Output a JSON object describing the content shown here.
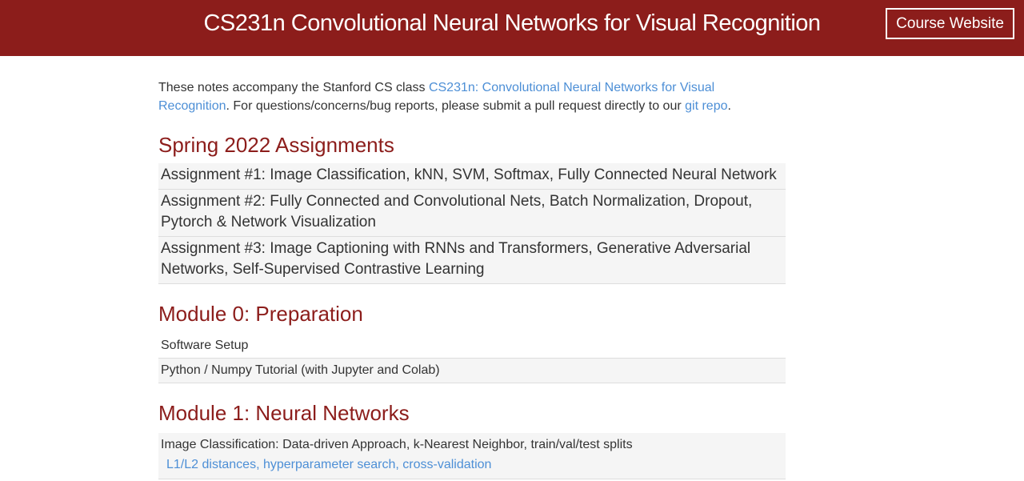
{
  "header": {
    "title": "CS231n Convolutional Neural Networks for Visual Recognition",
    "course_button": "Course Website"
  },
  "intro": {
    "text_before": "These notes accompany the Stanford CS class ",
    "link_class": "CS231n: Convolutional Neural Networks for Visual Recognition",
    "text_middle": ". For questions/concerns/bug reports, please submit a pull request directly to our ",
    "link_repo": "git repo",
    "text_after": "."
  },
  "assignments": {
    "title": "Spring 2022 Assignments",
    "items": [
      "Assignment #1: Image Classification, kNN, SVM, Softmax, Fully Connected Neural Network",
      "Assignment #2: Fully Connected and Convolutional Nets, Batch Normalization, Dropout, Pytorch & Network Visualization",
      "Assignment #3: Image Captioning with RNNs and Transformers, Generative Adversarial Networks, Self-Supervised Contrastive Learning"
    ]
  },
  "module0": {
    "title": "Module 0: Preparation",
    "items": [
      "Software Setup",
      "Python / Numpy Tutorial (with Jupyter and Colab)"
    ]
  },
  "module1": {
    "title": "Module 1: Neural Networks",
    "items": [
      {
        "title": "Image Classification: Data-driven Approach, k-Nearest Neighbor, train/val/test splits",
        "links": "L1/L2 distances, hyperparameter search, cross-validation"
      }
    ]
  },
  "colors": {
    "header_bg": "#8c1d1b",
    "accent": "#8c1d1b",
    "link": "#4d8fd6"
  }
}
